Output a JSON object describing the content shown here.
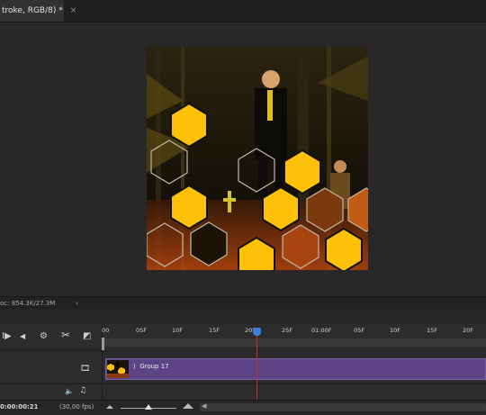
{
  "document_tab": {
    "title": "troke, RGB/8) *",
    "close_glyph": "×"
  },
  "status_bar": {
    "doc_info": "oc: 854.3K/27.3M",
    "more_glyph": "›"
  },
  "timeline": {
    "controls": {
      "play_glyph": "I▶",
      "prev_frame_glyph": "◀",
      "settings_glyph": "⚙",
      "split_glyph": "✂",
      "transition_glyph": "◩"
    },
    "ruler_labels": [
      "00",
      "05F",
      "10F",
      "15F",
      "20F",
      "25F",
      "01:00F",
      "05F",
      "10F",
      "15F",
      "20F"
    ],
    "playhead_label": "20",
    "clip": {
      "label": "Group 17",
      "expand_glyph": "⟩"
    },
    "track_icons": {
      "video_glyph": "🎞",
      "audio_volume_glyph": "🔈",
      "audio_note_glyph": "♫"
    },
    "current_time": "0:00:00:21",
    "fps": "(30,00 fps)"
  },
  "colors": {
    "accent_clip": "#5c4487",
    "playhead": "#d02a2a",
    "playhead_head": "#3b7fd8",
    "hex_fill": "#ffc107"
  }
}
